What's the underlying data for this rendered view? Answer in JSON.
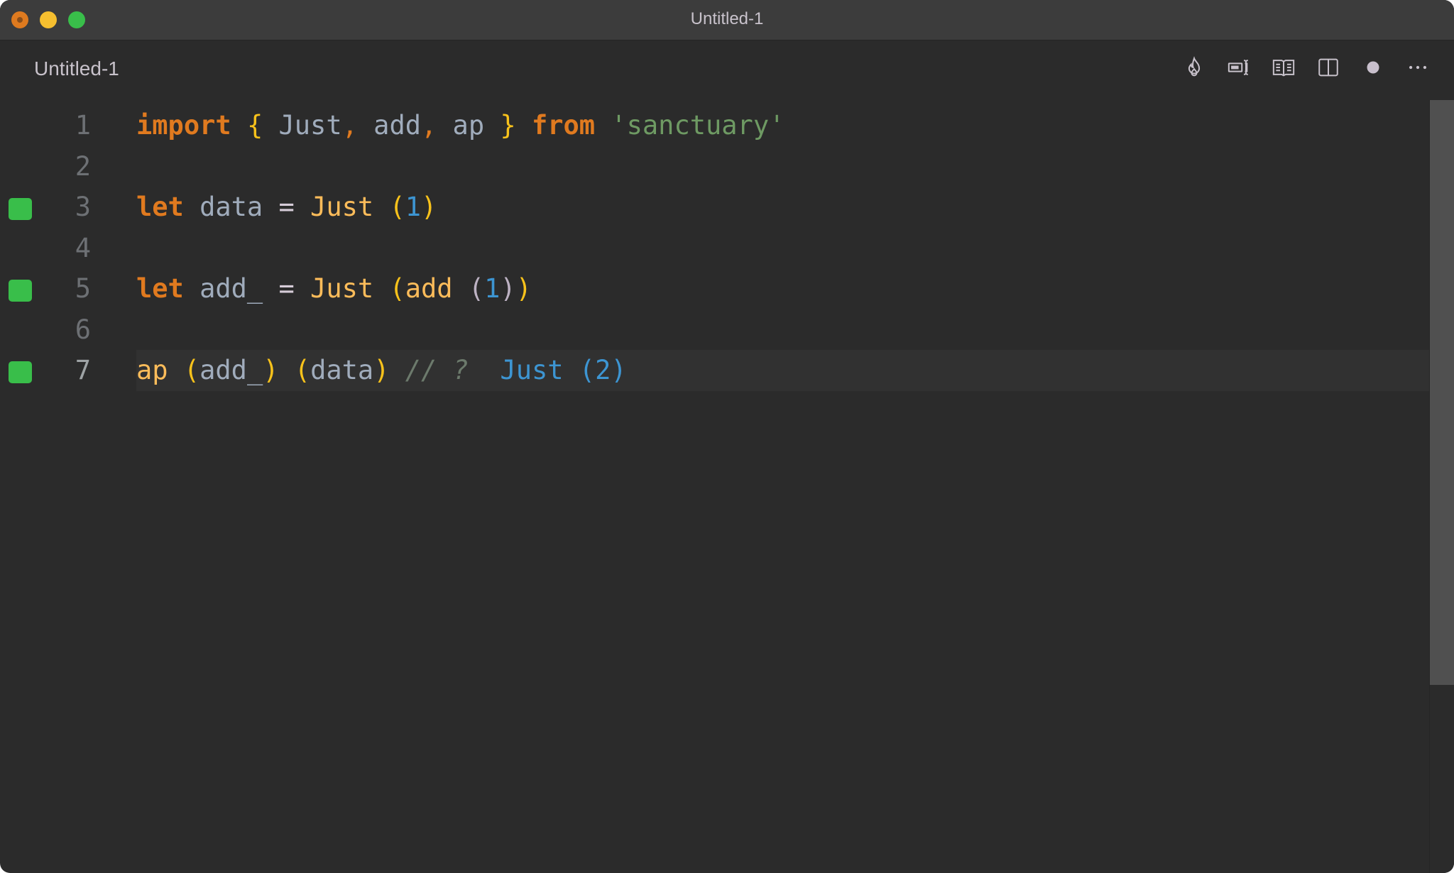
{
  "window": {
    "title": "Untitled-1",
    "traffic_lights": [
      "close",
      "minimize",
      "maximize"
    ]
  },
  "tab": {
    "label": "Untitled-1",
    "actions": [
      {
        "name": "flame-icon",
        "label": "Quokka"
      },
      {
        "name": "text-cursor-icon",
        "label": "Toggle value"
      },
      {
        "name": "open-book-icon",
        "label": "Open preview"
      },
      {
        "name": "split-editor-icon",
        "label": "Split editor"
      },
      {
        "name": "unsaved-dot-icon",
        "label": "Unsaved changes"
      },
      {
        "name": "more-icon",
        "label": "More actions"
      }
    ]
  },
  "editor": {
    "lines": [
      {
        "number": "1",
        "marker": false,
        "tokens": [
          {
            "t": "import",
            "c": "kw"
          },
          {
            "t": " ",
            "c": ""
          },
          {
            "t": "{",
            "c": "brace"
          },
          {
            "t": " Just",
            "c": ""
          },
          {
            "t": ",",
            "c": "punct"
          },
          {
            "t": " add",
            "c": ""
          },
          {
            "t": ",",
            "c": "punct"
          },
          {
            "t": " ap ",
            "c": ""
          },
          {
            "t": "}",
            "c": "brace"
          },
          {
            "t": " ",
            "c": ""
          },
          {
            "t": "from",
            "c": "kw"
          },
          {
            "t": " ",
            "c": ""
          },
          {
            "t": "'sanctuary'",
            "c": "str"
          }
        ]
      },
      {
        "number": "2",
        "marker": false,
        "tokens": []
      },
      {
        "number": "3",
        "marker": true,
        "tokens": [
          {
            "t": "let",
            "c": "kw"
          },
          {
            "t": " data ",
            "c": ""
          },
          {
            "t": "=",
            "c": "op"
          },
          {
            "t": " ",
            "c": ""
          },
          {
            "t": "Just",
            "c": "fn"
          },
          {
            "t": " ",
            "c": ""
          },
          {
            "t": "(",
            "c": "brace"
          },
          {
            "t": "1",
            "c": "num"
          },
          {
            "t": ")",
            "c": "brace"
          }
        ]
      },
      {
        "number": "4",
        "marker": false,
        "tokens": []
      },
      {
        "number": "5",
        "marker": true,
        "tokens": [
          {
            "t": "let",
            "c": "kw"
          },
          {
            "t": " add_ ",
            "c": ""
          },
          {
            "t": "=",
            "c": "op"
          },
          {
            "t": " ",
            "c": ""
          },
          {
            "t": "Just",
            "c": "fn"
          },
          {
            "t": " ",
            "c": ""
          },
          {
            "t": "(",
            "c": "brace"
          },
          {
            "t": "add",
            "c": "fn"
          },
          {
            "t": " ",
            "c": ""
          },
          {
            "t": "(",
            "c": "paren2"
          },
          {
            "t": "1",
            "c": "num"
          },
          {
            "t": ")",
            "c": "paren2"
          },
          {
            "t": ")",
            "c": "brace"
          }
        ]
      },
      {
        "number": "6",
        "marker": false,
        "tokens": []
      },
      {
        "number": "7",
        "marker": true,
        "current": true,
        "tokens": [
          {
            "t": "ap",
            "c": "fn"
          },
          {
            "t": " ",
            "c": ""
          },
          {
            "t": "(",
            "c": "brace"
          },
          {
            "t": "add_",
            "c": ""
          },
          {
            "t": ")",
            "c": "brace"
          },
          {
            "t": " ",
            "c": ""
          },
          {
            "t": "(",
            "c": "brace"
          },
          {
            "t": "data",
            "c": ""
          },
          {
            "t": ")",
            "c": "brace"
          },
          {
            "t": " ",
            "c": ""
          },
          {
            "t": "// ?",
            "c": "comment"
          },
          {
            "t": "  ",
            "c": ""
          },
          {
            "t": "Just (2)",
            "c": "result"
          }
        ]
      }
    ]
  },
  "colors": {
    "background": "#2b2b2b",
    "titlebar": "#3c3c3c",
    "keyword": "#e07a1f",
    "string": "#6e9a63",
    "function": "#fdbc5a",
    "number": "#3d95d2",
    "marker": "#39be4a"
  }
}
